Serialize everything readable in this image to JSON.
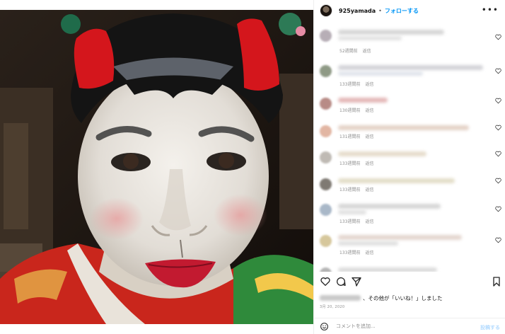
{
  "post": {
    "username": "925yamada",
    "separator": "•",
    "follow_label": "フォローする",
    "more_icon": "more-icon",
    "likes_suffix": "、その他が「いいね！」しました",
    "date": "3月 20, 2020",
    "comment_placeholder": "コメントを追加...",
    "post_label": "投稿する"
  },
  "comments": [
    {
      "age": "52週間前",
      "reply": "返信"
    },
    {
      "age": "133週間前",
      "reply": "返信"
    },
    {
      "age": "130週間前",
      "reply": "返信"
    },
    {
      "age": "131週間前",
      "reply": "返信"
    },
    {
      "age": "133週間前",
      "reply": "返信"
    },
    {
      "age": "133週間前",
      "reply": "返信"
    },
    {
      "age": "133週間前",
      "reply": "返信"
    },
    {
      "age": "133週間前",
      "reply": "返信"
    }
  ],
  "colors": {
    "link": "#0095f6",
    "muted": "#8e8e8e",
    "text": "#111111"
  }
}
